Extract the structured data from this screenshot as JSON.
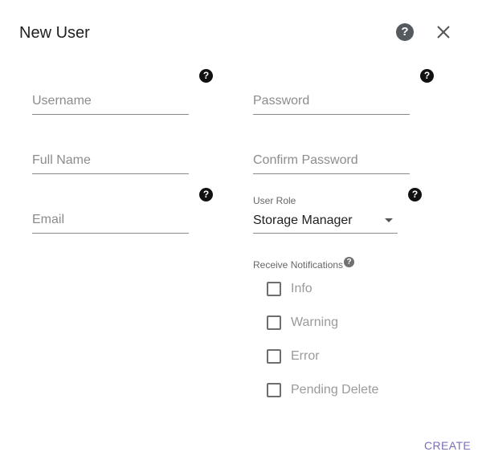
{
  "dialog": {
    "title": "New User",
    "help_glyph": "?",
    "close_icon": "close-icon"
  },
  "fields": {
    "username": {
      "placeholder": "Username",
      "value": ""
    },
    "password": {
      "placeholder": "Password",
      "value": ""
    },
    "full_name": {
      "placeholder": "Full Name",
      "value": ""
    },
    "confirm_password": {
      "placeholder": "Confirm Password",
      "value": ""
    },
    "email": {
      "placeholder": "Email",
      "value": ""
    }
  },
  "help": {
    "glyph": "?"
  },
  "user_role": {
    "label": "User Role",
    "selected": "Storage Manager"
  },
  "notifications": {
    "label": "Receive Notifications",
    "options": [
      {
        "label": "Info",
        "checked": false
      },
      {
        "label": "Warning",
        "checked": false
      },
      {
        "label": "Error",
        "checked": false
      },
      {
        "label": "Pending Delete",
        "checked": false
      }
    ]
  },
  "actions": {
    "create_label": "CREATE"
  },
  "colors": {
    "accent": "#7b6fb5",
    "help_icon_dark": "#111111",
    "header_help": "#555a60"
  }
}
